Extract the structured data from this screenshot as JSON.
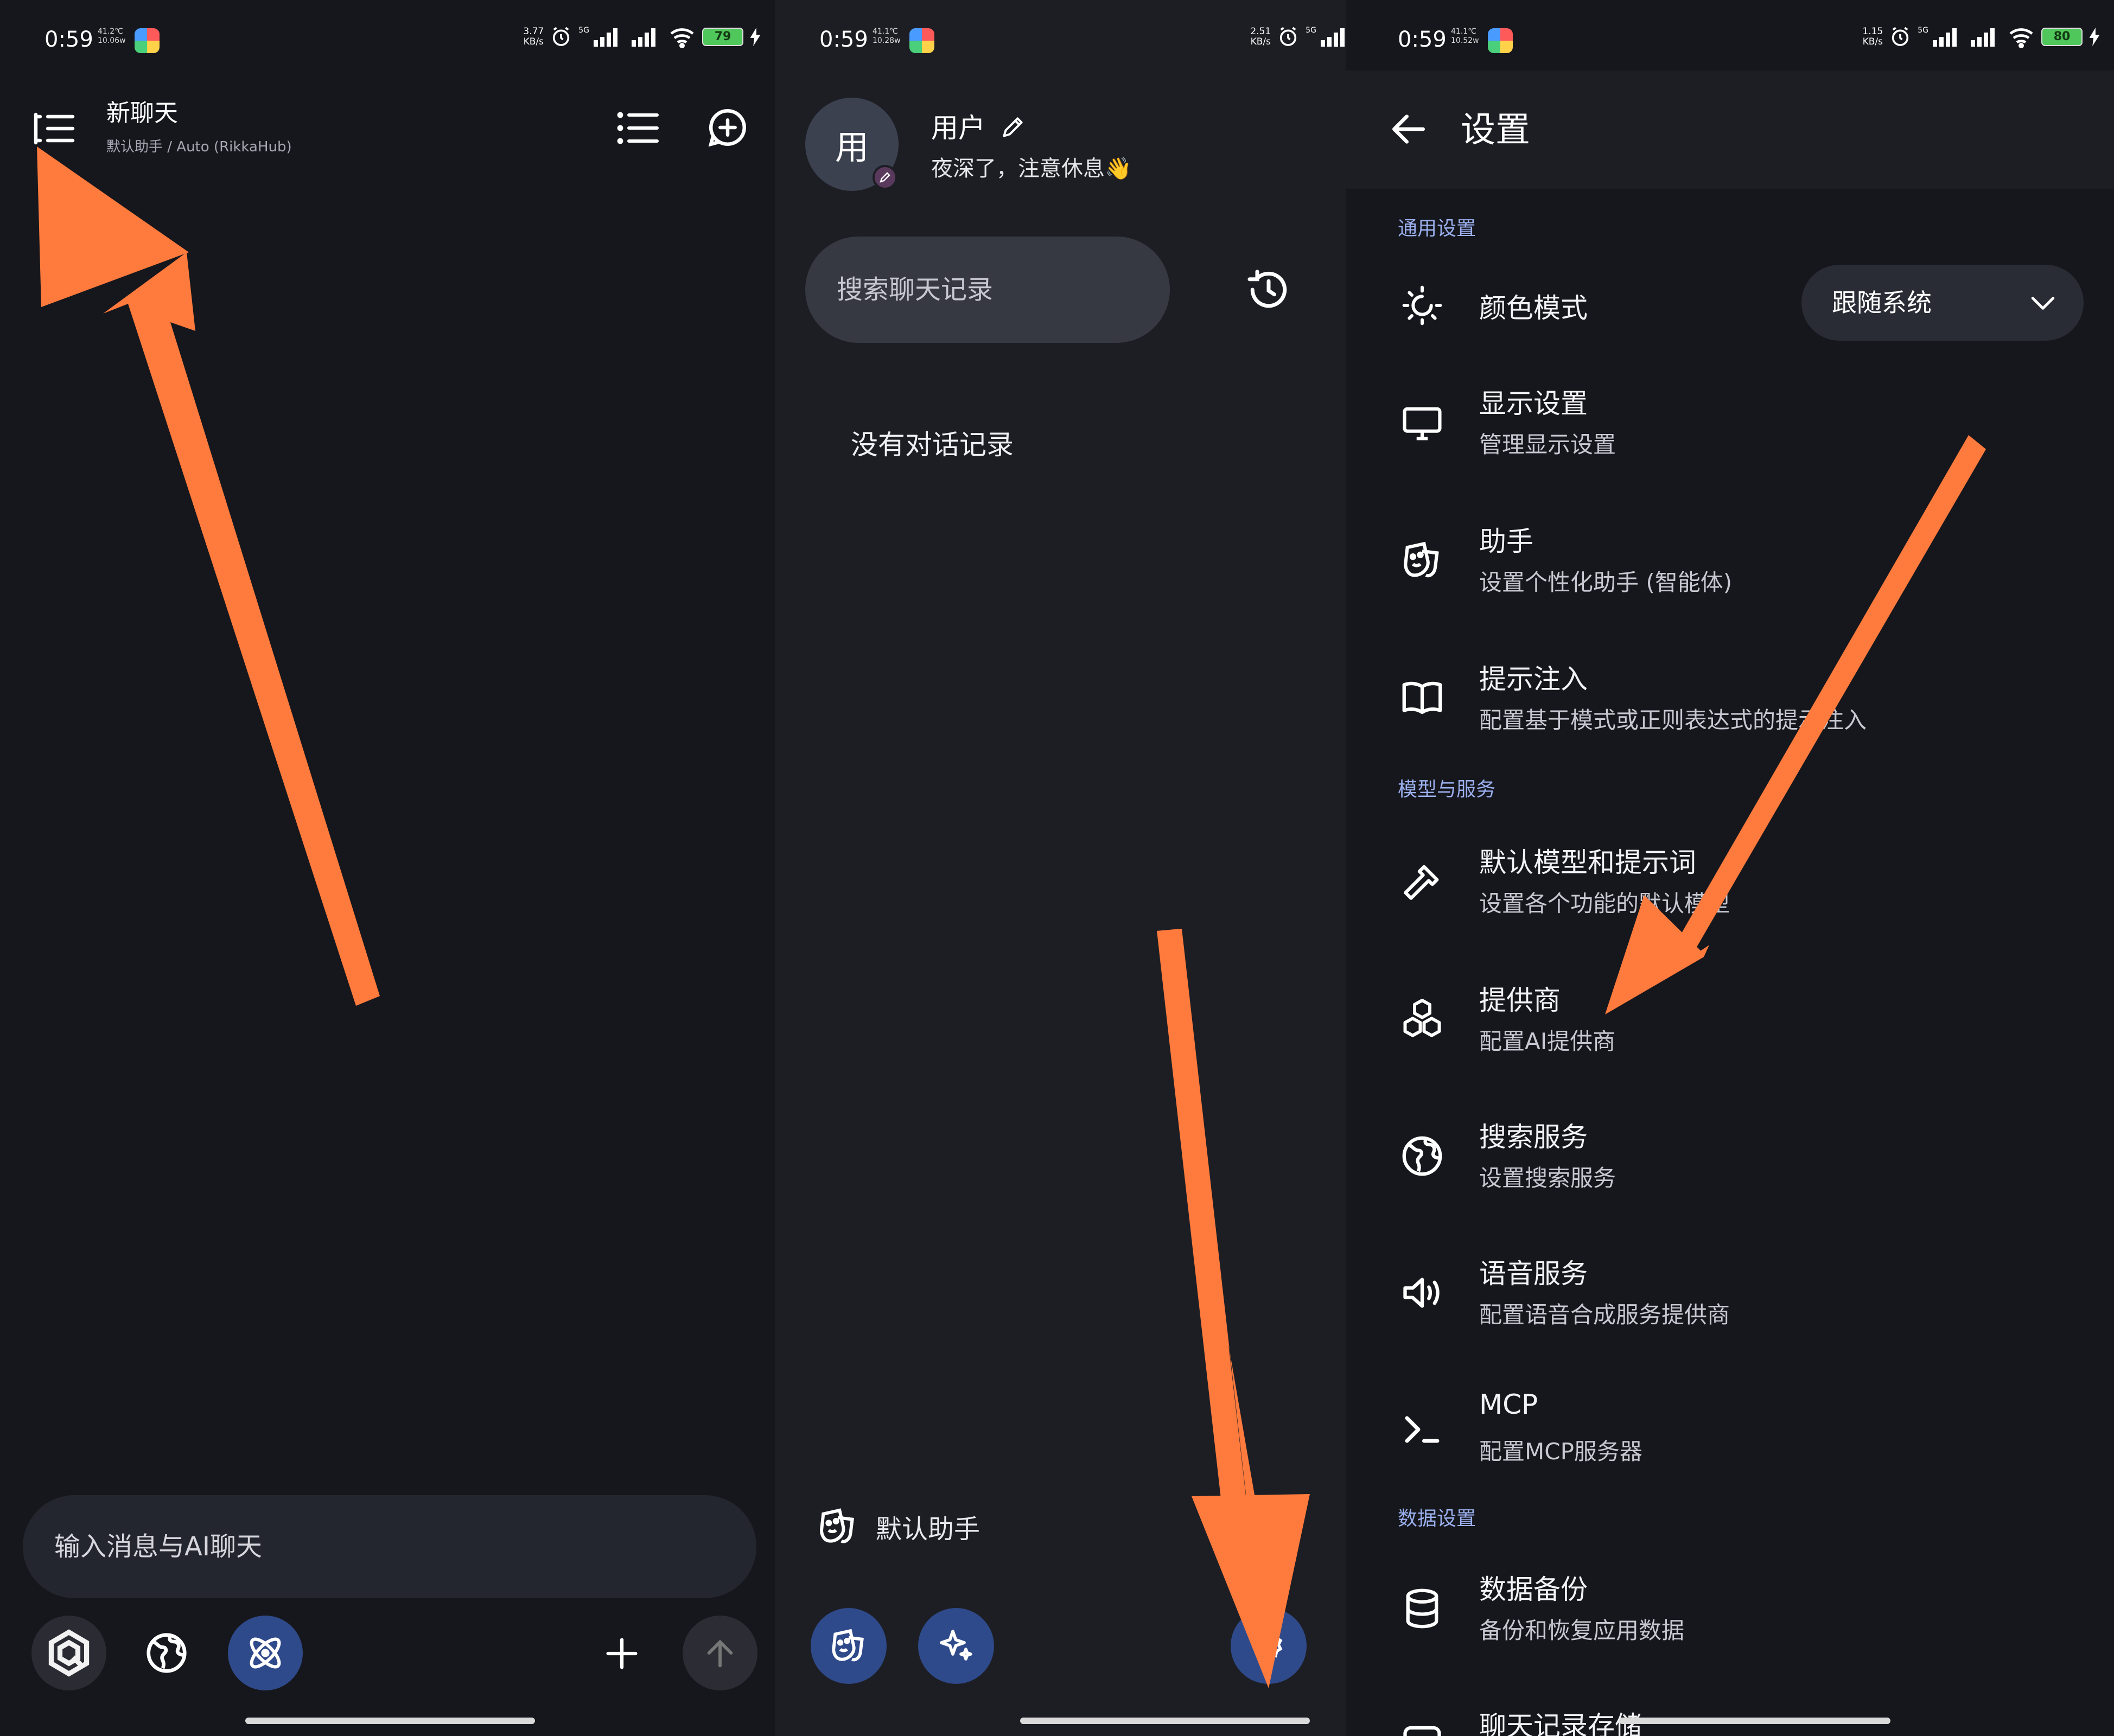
{
  "status_bars": [
    {
      "time": "0:59",
      "temp": "41.2℃",
      "power": "10.06w",
      "speed": "3.77",
      "unit": "KB/s",
      "net": "5G",
      "battery": "79"
    },
    {
      "time": "0:59",
      "temp": "41.1℃",
      "power": "10.28w",
      "speed": "2.51",
      "unit": "KB/s",
      "net": "5G"
    },
    {
      "time": "0:59",
      "temp": "41.1℃",
      "power": "10.52w",
      "speed": "1.15",
      "unit": "KB/s",
      "net": "5G",
      "battery": "80"
    }
  ],
  "chat": {
    "title": "新聊天",
    "subtitle": "默认助手 / Auto (RikkaHub)",
    "input_placeholder": "输入消息与AI聊天"
  },
  "drawer": {
    "avatar_letter": "用",
    "username": "用户",
    "greeting": "夜深了，注意休息",
    "greeting_emoji": "👋",
    "search_placeholder": "搜索聊天记录",
    "empty_text": "没有对话记录",
    "assistant_label": "默认助手"
  },
  "settings": {
    "title": "设置",
    "sections": {
      "general": "通用设置",
      "models": "模型与服务",
      "data": "数据设置"
    },
    "color_mode": {
      "title": "颜色模式",
      "value": "跟随系统"
    },
    "items": [
      {
        "title": "显示设置",
        "subtitle": "管理显示设置"
      },
      {
        "title": "助手",
        "subtitle": "设置个性化助手 (智能体)"
      },
      {
        "title": "提示注入",
        "subtitle": "配置基于模式或正则表达式的提示注入"
      },
      {
        "title": "默认模型和提示词",
        "subtitle": "设置各个功能的默认模型"
      },
      {
        "title": "提供商",
        "subtitle": "配置AI提供商"
      },
      {
        "title": "搜索服务",
        "subtitle": "设置搜索服务"
      },
      {
        "title": "语音服务",
        "subtitle": "配置语音合成服务提供商"
      },
      {
        "title": "MCP",
        "subtitle": "配置MCP服务器"
      },
      {
        "title": "数据备份",
        "subtitle": "备份和恢复应用数据"
      },
      {
        "title": "聊天记录存储",
        "subtitle": ""
      }
    ]
  },
  "colors": {
    "arrow": "#ff7a3d",
    "accent_blue": "#2f4a8a",
    "section_label": "#9bb0ef",
    "background": "#16171c"
  },
  "icons": [
    "menu-icon",
    "list-icon",
    "new-chat-icon",
    "pencil-icon",
    "history-icon",
    "back-arrow-icon",
    "brightness-icon",
    "monitor-icon",
    "mask-icon",
    "book-icon",
    "hammer-icon",
    "cubes-icon",
    "globe-icon",
    "speaker-icon",
    "terminal-icon",
    "database-icon",
    "gear-icon",
    "sparkle-icon",
    "atom-icon",
    "plus-icon",
    "arrow-up-icon",
    "chevron-down-icon"
  ]
}
